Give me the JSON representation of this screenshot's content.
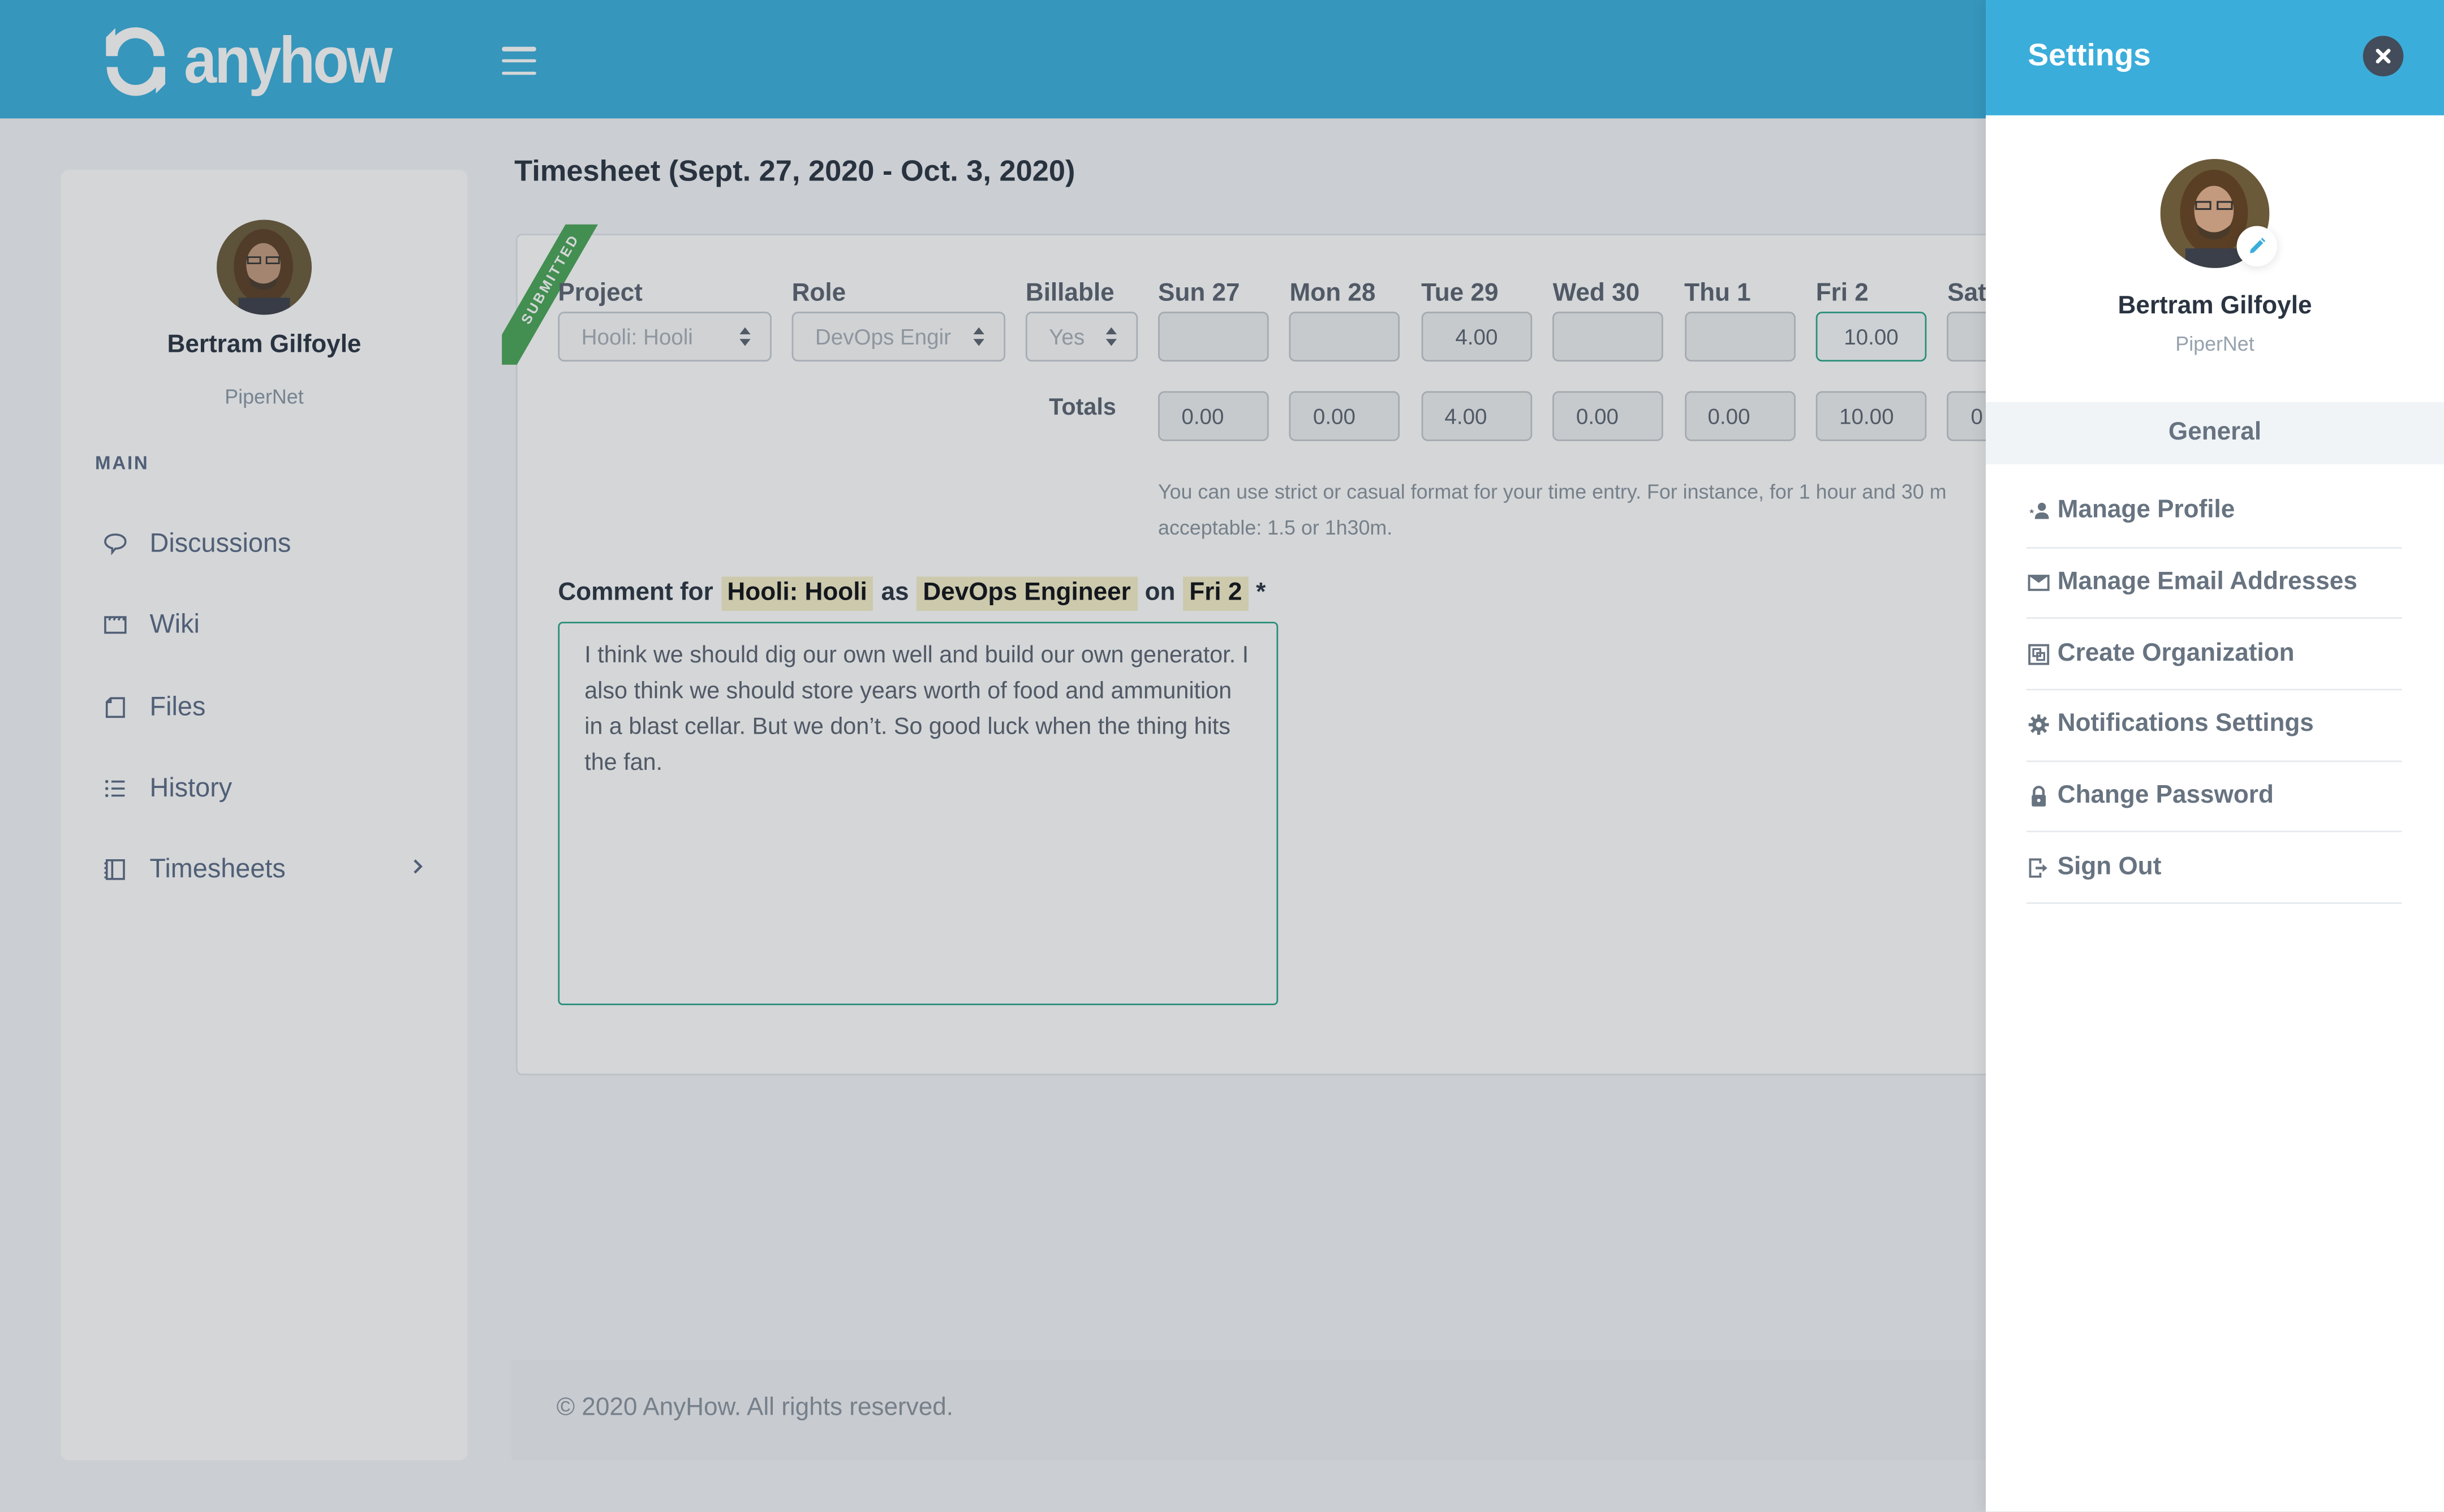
{
  "app": {
    "brand": "anyhow",
    "colors": {
      "primary": "#3ab0dc",
      "accent_green": "#2aa68a",
      "ribbon_green": "#4aa657",
      "text_dark": "#2a3441",
      "text_muted": "#5b6b85"
    }
  },
  "topbar": {
    "logo_icon": "refresh-arrows-icon",
    "menu_icon": "hamburger-icon"
  },
  "sidebar": {
    "user": {
      "name": "Bertram Gilfoyle",
      "org": "PiperNet"
    },
    "section_label": "MAIN",
    "items": [
      {
        "label": "Discussions",
        "icon": "speech-bubble-icon"
      },
      {
        "label": "Wiki",
        "icon": "clapperboard-icon"
      },
      {
        "label": "Files",
        "icon": "file-icon"
      },
      {
        "label": "History",
        "icon": "list-icon"
      },
      {
        "label": "Timesheets",
        "icon": "notebook-icon",
        "has_submenu": true
      }
    ]
  },
  "main": {
    "title": "Timesheet (Sept. 27, 2020 - Oct. 3, 2020)",
    "status_ribbon": "SUBMITTED",
    "columns": {
      "project": "Project",
      "role": "Role",
      "billable": "Billable"
    },
    "row": {
      "project": "Hooli: Hooli",
      "role": "DevOps Engir",
      "billable": "Yes"
    },
    "days": [
      {
        "label": "Sun 27",
        "value": "",
        "total": "0.00"
      },
      {
        "label": "Mon 28",
        "value": "",
        "total": "0.00"
      },
      {
        "label": "Tue 29",
        "value": "4.00",
        "total": "4.00"
      },
      {
        "label": "Wed 30",
        "value": "",
        "total": "0.00"
      },
      {
        "label": "Thu 1",
        "value": "",
        "total": "0.00"
      },
      {
        "label": "Fri 2",
        "value": "10.00",
        "total": "10.00",
        "focused": true
      },
      {
        "label": "Sat",
        "value": "",
        "total": "0"
      }
    ],
    "totals_label": "Totals",
    "hint_line1": "You can use strict or casual format for your time entry. For instance, for 1 hour and 30 m",
    "hint_line2": "acceptable: 1.5 or 1h30m.",
    "comment": {
      "prefix": "Comment for",
      "project": "Hooli: Hooli",
      "as": "as",
      "role": "DevOps Engineer",
      "on": "on",
      "day": "Fri 2",
      "required": "*",
      "text": "I think we should dig our own well and build our own generator. I also think we should store years worth of food and ammunition in a blast cellar. But we don’t. So good luck when the thing hits the fan."
    }
  },
  "footer": {
    "text": "© 2020 AnyHow. All rights reserved."
  },
  "settings": {
    "title": "Settings",
    "user": {
      "name": "Bertram Gilfoyle",
      "org": "PiperNet"
    },
    "section": "General",
    "items": [
      {
        "label": "Manage Profile",
        "icon": "user-star-icon"
      },
      {
        "label": "Manage Email Addresses",
        "icon": "envelope-icon"
      },
      {
        "label": "Create Organization",
        "icon": "organization-icon"
      },
      {
        "label": "Notifications Settings",
        "icon": "gear-icon"
      },
      {
        "label": "Change Password",
        "icon": "lock-icon"
      },
      {
        "label": "Sign Out",
        "icon": "sign-out-icon"
      }
    ]
  }
}
